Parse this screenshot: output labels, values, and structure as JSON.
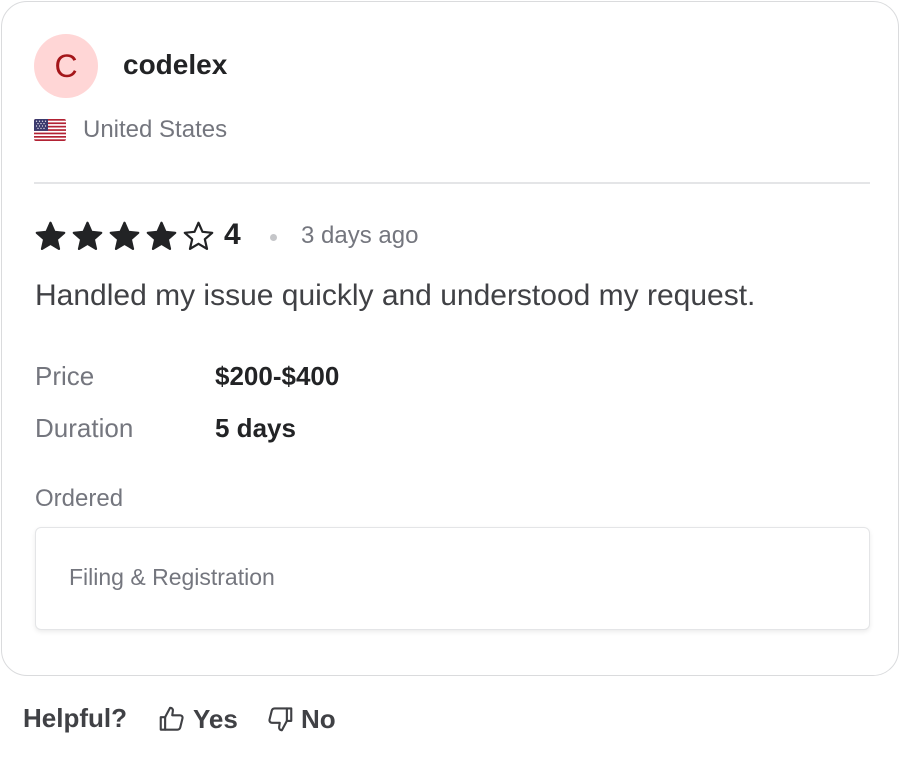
{
  "review": {
    "avatar_letter": "C",
    "username": "codelex",
    "country": "United States",
    "country_flag_icon": "us-flag-icon",
    "rating_value": 4,
    "rating_max": 5,
    "rating_display": "4",
    "time_ago": "3 days ago",
    "text": "Handled my issue quickly and understood my request.",
    "details": [
      {
        "label": "Price",
        "value": "$200-$400"
      },
      {
        "label": "Duration",
        "value": "5 days"
      }
    ],
    "ordered_label": "Ordered",
    "ordered_item": "Filing & Registration"
  },
  "helpful": {
    "label": "Helpful?",
    "yes_label": "Yes",
    "no_label": "No",
    "yes_icon": "thumbs-up-icon",
    "no_icon": "thumbs-down-icon"
  },
  "colors": {
    "avatar_bg": "#ffd6d6",
    "avatar_text": "#a4161a",
    "star_fill": "#222325",
    "muted_text": "#74767e",
    "border": "#dadbdd"
  }
}
